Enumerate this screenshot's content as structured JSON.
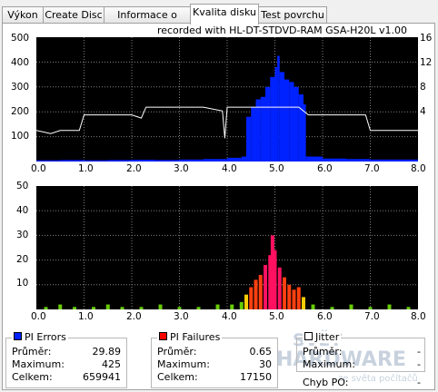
{
  "tabs": [
    {
      "label": "Výkon",
      "active": false
    },
    {
      "label": "Create Disc",
      "active": false
    },
    {
      "label": "Informace o disku",
      "active": false
    },
    {
      "label": "Kvalita disku",
      "active": true
    },
    {
      "label": "Test povrchu",
      "active": false
    }
  ],
  "recorded_label": "recorded with HL-DT-STDVD-RAM GSA-H20L v1.00",
  "colors": {
    "pi_errors": "#0022ff",
    "pi_failures": "#ff0000",
    "jitter": "#ffffff",
    "grid": "#7f7f7f",
    "background": "#000000"
  },
  "chart_data": [
    {
      "type": "area",
      "name": "pi-errors-jitter",
      "xlim": [
        0,
        8
      ],
      "ylim": [
        0,
        500
      ],
      "y2lim": [
        0,
        16
      ],
      "x_ticks": [
        "0.0",
        "1.0",
        "2.0",
        "3.0",
        "4.0",
        "5.0",
        "6.0",
        "7.0",
        "8.0"
      ],
      "y_ticks": [
        "100",
        "200",
        "300",
        "400",
        "500"
      ],
      "y2_ticks": [
        "4",
        "8",
        "12",
        "16"
      ],
      "grid": true,
      "series": [
        {
          "name": "PI Errors",
          "values": [
            [
              0.0,
              5
            ],
            [
              0.5,
              6
            ],
            [
              1.0,
              5
            ],
            [
              1.5,
              6
            ],
            [
              2.0,
              7
            ],
            [
              2.5,
              6
            ],
            [
              3.0,
              8
            ],
            [
              3.5,
              10
            ],
            [
              4.0,
              15
            ],
            [
              4.3,
              20
            ],
            [
              4.4,
              180
            ],
            [
              4.5,
              220
            ],
            [
              4.6,
              250
            ],
            [
              4.7,
              260
            ],
            [
              4.8,
              300
            ],
            [
              4.9,
              340
            ],
            [
              5.0,
              380
            ],
            [
              5.05,
              425
            ],
            [
              5.1,
              360
            ],
            [
              5.2,
              330
            ],
            [
              5.3,
              320
            ],
            [
              5.4,
              300
            ],
            [
              5.5,
              270
            ],
            [
              5.6,
              230
            ],
            [
              5.65,
              20
            ],
            [
              6.0,
              12
            ],
            [
              6.5,
              10
            ],
            [
              7.0,
              8
            ],
            [
              7.5,
              8
            ],
            [
              8.0,
              7
            ]
          ]
        },
        {
          "name": "Jitter",
          "values": [
            [
              0.0,
              4.0
            ],
            [
              0.3,
              3.6
            ],
            [
              0.5,
              4.0
            ],
            [
              0.9,
              4.0
            ],
            [
              1.0,
              6.0
            ],
            [
              1.5,
              6.0
            ],
            [
              2.0,
              6.0
            ],
            [
              2.2,
              5.6
            ],
            [
              2.3,
              7.0
            ],
            [
              3.0,
              7.0
            ],
            [
              3.5,
              7.0
            ],
            [
              3.9,
              6.5
            ],
            [
              3.95,
              3.0
            ],
            [
              4.0,
              7.0
            ],
            [
              4.5,
              7.0
            ],
            [
              5.0,
              7.0
            ],
            [
              5.5,
              7.0
            ],
            [
              5.7,
              6.0
            ],
            [
              6.0,
              6.0
            ],
            [
              6.5,
              6.0
            ],
            [
              6.9,
              6.0
            ],
            [
              7.0,
              4.0
            ],
            [
              7.5,
              4.0
            ],
            [
              8.0,
              4.0
            ]
          ]
        }
      ]
    },
    {
      "type": "bar",
      "name": "pi-failures",
      "xlim": [
        0,
        8
      ],
      "ylim": [
        0,
        50
      ],
      "x_ticks": [
        "0.0",
        "1.0",
        "2.0",
        "3.0",
        "4.0",
        "5.0",
        "6.0",
        "7.0",
        "8.0"
      ],
      "y_ticks": [
        "10",
        "20",
        "30",
        "40",
        "50"
      ],
      "grid": true,
      "series": [
        {
          "name": "PI Failures",
          "values": [
            [
              0.2,
              1
            ],
            [
              0.5,
              2
            ],
            [
              0.8,
              1
            ],
            [
              1.2,
              1
            ],
            [
              1.5,
              2
            ],
            [
              1.8,
              1
            ],
            [
              2.2,
              1
            ],
            [
              2.6,
              2
            ],
            [
              3.0,
              1
            ],
            [
              3.4,
              1
            ],
            [
              3.8,
              2
            ],
            [
              4.1,
              2
            ],
            [
              4.3,
              3
            ],
            [
              4.4,
              6
            ],
            [
              4.5,
              9
            ],
            [
              4.6,
              12
            ],
            [
              4.7,
              14
            ],
            [
              4.8,
              18
            ],
            [
              4.9,
              22
            ],
            [
              4.95,
              30
            ],
            [
              5.0,
              24
            ],
            [
              5.1,
              17
            ],
            [
              5.2,
              13
            ],
            [
              5.3,
              10
            ],
            [
              5.4,
              8
            ],
            [
              5.5,
              9
            ],
            [
              5.6,
              5
            ],
            [
              5.8,
              2
            ],
            [
              6.2,
              1
            ],
            [
              6.6,
              2
            ],
            [
              7.0,
              1
            ],
            [
              7.4,
              2
            ],
            [
              7.8,
              1
            ]
          ]
        }
      ]
    }
  ],
  "stats": {
    "pi_errors": {
      "title": "PI Errors",
      "rows": [
        {
          "label": "Průměr:",
          "value": "29.89"
        },
        {
          "label": "Maximum:",
          "value": "425"
        },
        {
          "label": "Celkem:",
          "value": "659941"
        }
      ]
    },
    "pi_failures": {
      "title": "PI Failures",
      "rows": [
        {
          "label": "Průměr:",
          "value": "0.65"
        },
        {
          "label": "Maximum:",
          "value": "30"
        },
        {
          "label": "Celkem:",
          "value": "17150"
        }
      ]
    },
    "jitter": {
      "title": "Jitter",
      "rows": [
        {
          "label": "Průměr:",
          "value": "-"
        },
        {
          "label": "Maximum:",
          "value": "-"
        }
      ]
    },
    "chyb_po": {
      "label": "Chyb PO:",
      "value": "-"
    }
  },
  "watermark": {
    "line1": "SVĚT",
    "line2": "HARDWARE",
    "line3": "ze světa počítačů"
  }
}
